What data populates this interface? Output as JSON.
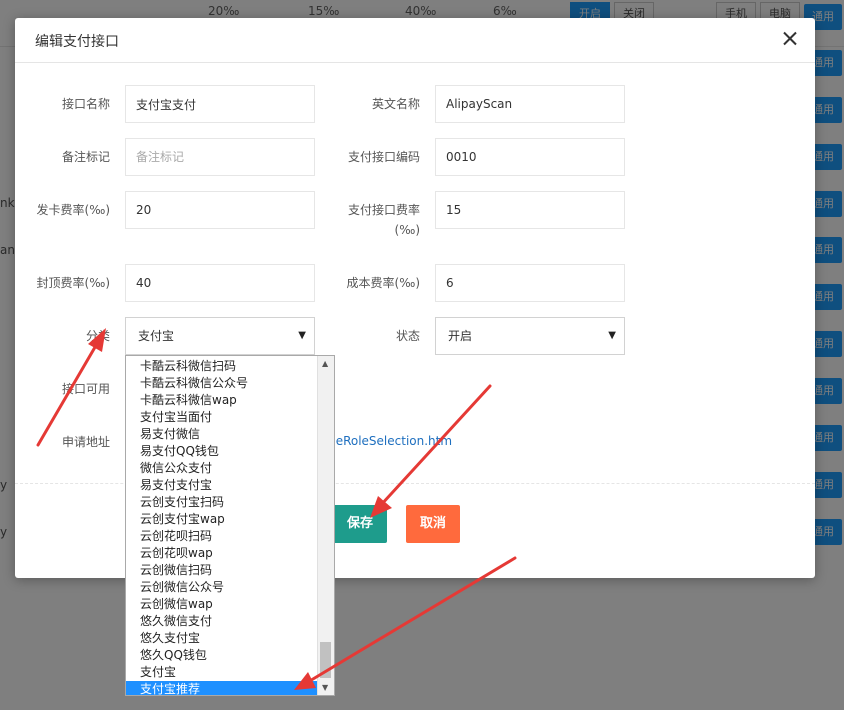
{
  "background": {
    "header_cells": [
      "20‰",
      "15‰",
      "40‰",
      "6‰"
    ],
    "header_buttons": [
      "开启",
      "关闭"
    ],
    "header_right_buttons": [
      "手机",
      "电脑"
    ],
    "tag_label": "通用",
    "left_fragments": [
      "nk",
      "an",
      "y",
      "y"
    ]
  },
  "modal": {
    "title": "编辑支付接口",
    "fields": {
      "interface_name": {
        "label": "接口名称",
        "value": "支付宝支付"
      },
      "english_name": {
        "label": "英文名称",
        "value": "AlipayScan"
      },
      "remark": {
        "label": "备注标记",
        "placeholder": "备注标记",
        "value": ""
      },
      "interface_code": {
        "label": "支付接口编码",
        "value": "0010"
      },
      "card_rate": {
        "label": "发卡费率(‰)",
        "value": "20"
      },
      "interface_rate": {
        "label_line1": "支付接口费率",
        "label_line2": "(‰)",
        "value": "15"
      },
      "cap_rate": {
        "label": "封顶费率(‰)",
        "value": "40"
      },
      "cost_rate": {
        "label": "成本费率(‰)",
        "value": "6"
      },
      "category": {
        "label": "分类",
        "value": "支付宝"
      },
      "status": {
        "label": "状态",
        "value": "开启"
      },
      "available": {
        "label": "接口可用"
      },
      "apply_url": {
        "label": "申请地址",
        "link_text": "meRoleSelection.htm"
      }
    },
    "buttons": {
      "save": "保存",
      "cancel": "取消"
    }
  },
  "dropdown": {
    "items": [
      "卡酷云科微信扫码",
      "卡酷云科微信公众号",
      "卡酷云科微信wap",
      "支付宝当面付",
      "易支付微信",
      "易支付QQ钱包",
      "微信公众支付",
      "易支付支付宝",
      "云创支付宝扫码",
      "云创支付宝wap",
      "云创花呗扫码",
      "云创花呗wap",
      "云创微信扫码",
      "云创微信公众号",
      "云创微信wap",
      "悠久微信支付",
      "悠久支付宝",
      "悠久QQ钱包",
      "支付宝",
      "支付宝推荐"
    ],
    "selected": "支付宝推荐"
  },
  "colors": {
    "accent": "#1e90ff",
    "save": "#1e9c8c",
    "cancel": "#ff6a3d",
    "annotation": "#e53935"
  }
}
